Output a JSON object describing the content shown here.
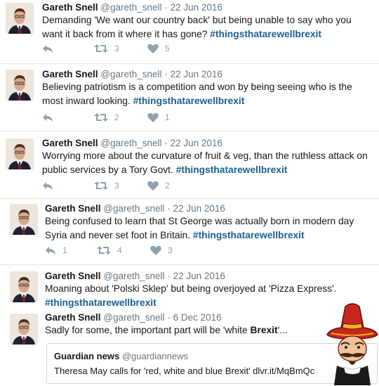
{
  "tweets": [
    {
      "name": "Gareth Snell",
      "handle": "@gareth_snell",
      "dot": "·",
      "date": "22 Jun 2016",
      "text": "Demanding 'We want our country back' but being unable to say who you want it back from it where it has gone? ",
      "hashtag": "#thingsthatarewellbrexit",
      "reply_count": "",
      "retweet_count": "3",
      "like_count": "5"
    },
    {
      "name": "Gareth Snell",
      "handle": "@gareth_snell",
      "dot": "·",
      "date": "22 Jun 2016",
      "text": "Believing patriotism is a competition and won by being seeing who is the most inward looking.  ",
      "hashtag": "#thingsthatarewellbrexit",
      "reply_count": "",
      "retweet_count": "2",
      "like_count": "1"
    },
    {
      "name": "Gareth Snell",
      "handle": "@gareth_snell",
      "dot": "·",
      "date": "22 Jun 2016",
      "text": "Worrying more about the curvature of fruit & veg, than the ruthless attack on public services by a Tory Govt.  ",
      "hashtag": "#thingsthatarewellbrexit",
      "reply_count": "",
      "retweet_count": "3",
      "like_count": "2"
    },
    {
      "name": "Gareth Snell",
      "handle": "@gareth_snell",
      "dot": "·",
      "date": "22 Jun 2016",
      "text": "Being confused to learn that St George was actually born in modern day Syria and never set foot in Britain. ",
      "hashtag": "#thingsthatarewellbrexit",
      "reply_count": "1",
      "retweet_count": "4",
      "like_count": "3"
    },
    {
      "name": "Gareth Snell",
      "handle": "@gareth_snell",
      "dot": "·",
      "date": "22 Jun 2016",
      "text": "Moaning about 'Polski Sklep' but being overjoyed at 'Pizza Express'. ",
      "hashtag": "#thingsthatarewellbrexit"
    },
    {
      "name": "Gareth Snell",
      "handle": "@gareth_snell",
      "dot": "·",
      "date": "6 Dec 2016",
      "text_before": "Sadly for some, the important part will be 'white ",
      "text_bold": "Brexit",
      "text_after": "'..."
    }
  ],
  "quote": {
    "name": "Guardian news",
    "handle": "@guardiannews",
    "text": "Theresa May calls for 'red, white and blue Brexit' dlvr.it/MqBmQc"
  },
  "colors": {
    "hashtag": "#1b5f91",
    "muted": "#657786",
    "icon": "#8fa1af",
    "divider": "#e1e8ed"
  }
}
